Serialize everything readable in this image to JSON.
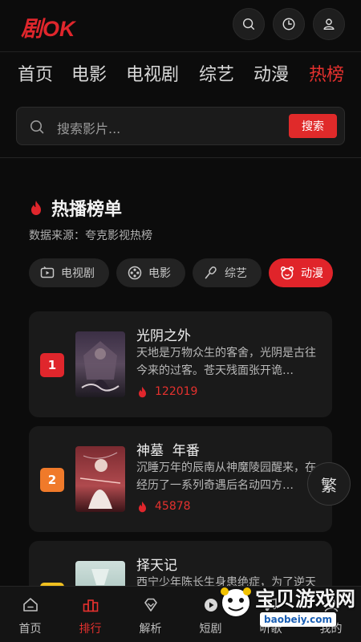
{
  "app": {
    "logo": "剧OK"
  },
  "nav": {
    "items": [
      "首页",
      "电影",
      "电视剧",
      "综艺",
      "动漫",
      "热榜"
    ],
    "active": 5
  },
  "search": {
    "placeholder": "搜索影片...",
    "button": "搜索"
  },
  "section": {
    "title": "热播榜单",
    "source": "数据来源：夸克影视热榜"
  },
  "categories": [
    {
      "label": "电视剧",
      "icon": "tv-icon"
    },
    {
      "label": "电影",
      "icon": "film-reel-icon"
    },
    {
      "label": "综艺",
      "icon": "microphone-icon"
    },
    {
      "label": "动漫",
      "icon": "bear-face-icon",
      "active": true
    }
  ],
  "list": [
    {
      "rank": "1",
      "rank_color": "#e0262c",
      "title": "光阴之外",
      "desc": "天地是万物众生的客舍，光阴是古往今来的过客。苍天残面张开诡…",
      "hot": "122019"
    },
    {
      "rank": "2",
      "rank_color": "#f07a2a",
      "title": "神墓  年番",
      "desc": "沉睡万年的辰南从神魔陵园醒来，在经历了一系列奇遇后名动四方…",
      "hot": "45878"
    },
    {
      "rank": "3",
      "rank_color": "#f0c020",
      "title": "择天记",
      "desc": "西宁少年陈长生身患绝症，为了逆天改命…",
      "hot": ""
    }
  ],
  "float_button": {
    "label": "繁"
  },
  "tabbar": {
    "items": [
      {
        "label": "首页",
        "icon": "home-icon"
      },
      {
        "label": "排行",
        "icon": "ranking-icon",
        "active": true
      },
      {
        "label": "解析",
        "icon": "diamond-icon"
      },
      {
        "label": "短剧",
        "icon": "play-icon"
      },
      {
        "label": "听歌",
        "icon": "music-icon"
      },
      {
        "label": "我的",
        "icon": "user-icon"
      }
    ]
  },
  "watermark": {
    "text": "宝贝游戏网",
    "url": "baobeiy.com"
  },
  "colors": {
    "accent": "#e5312e",
    "background": "#0c0c0c",
    "card": "#1a1a1a"
  }
}
